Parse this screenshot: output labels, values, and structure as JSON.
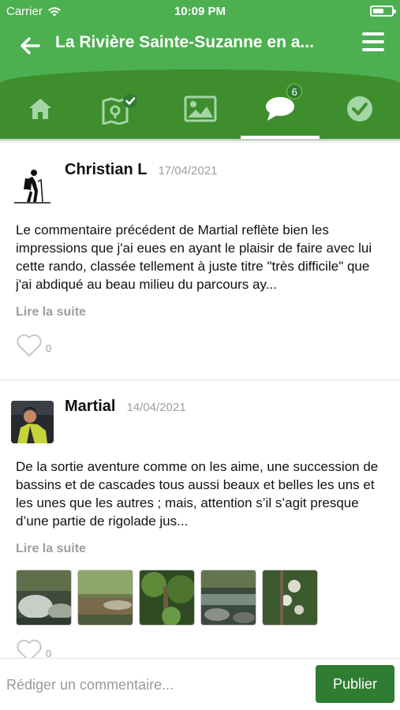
{
  "status_bar": {
    "carrier": "Carrier",
    "time": "10:09 PM"
  },
  "header": {
    "title": "La Rivière Sainte-Suzanne en a..."
  },
  "tabs": [
    {
      "name": "home-icon"
    },
    {
      "name": "map-check-icon"
    },
    {
      "name": "image-icon"
    },
    {
      "name": "comments-icon",
      "badge": "6",
      "active": true
    },
    {
      "name": "check-circle-icon"
    }
  ],
  "comments": [
    {
      "author": "Christian L",
      "date": "17/04/2021",
      "text": "Le commentaire précédent de Martial reflète bien les impressions que j'ai eues en ayant le plaisir de faire avec lui cette rando, classée tellement à juste titre \"très difficile\" que j'ai abdiqué au beau milieu du parcours ay...",
      "read_more": "Lire la suite",
      "likes": "0"
    },
    {
      "author": "Martial",
      "date": "14/04/2021",
      "text": "De la sortie aventure comme on les aime, une succession de bassins et de cascades tous aussi beaux et belles les uns et les unes que les autres ; mais, attention s’il s’agit presque d’une partie de rigolade jus...",
      "read_more": "Lire la suite",
      "likes": "0"
    }
  ],
  "composer": {
    "placeholder": "Rédiger un commentaire...",
    "publish_label": "Publier"
  },
  "colors": {
    "primary": "#4caf50",
    "dark": "#3e8e2e",
    "button": "#2e7d32"
  }
}
